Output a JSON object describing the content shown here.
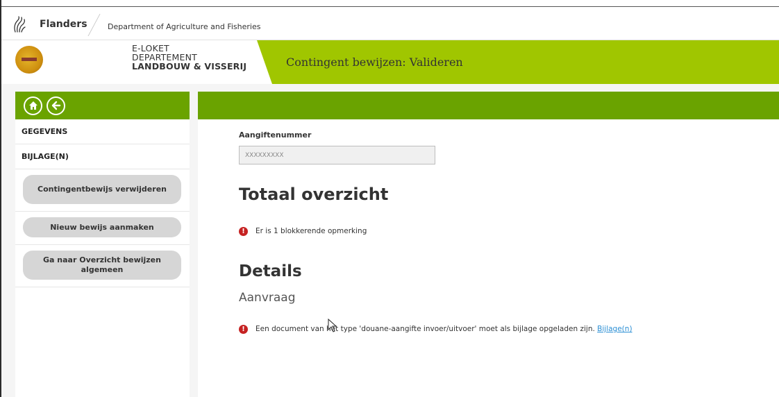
{
  "topbar": {
    "org": "Flanders",
    "department": "Department of Agriculture and Fisheries"
  },
  "header": {
    "eloket_line1": "E-LOKET",
    "eloket_line2": "DEPARTEMENT",
    "eloket_line3": "LANDBOUW & VISSERIJ",
    "page_title": "Contingent bewijzen: Valideren"
  },
  "sidebar": {
    "home_icon": "home-icon",
    "back_icon": "arrow-left-icon",
    "nav": [
      {
        "label": "GEGEVENS"
      },
      {
        "label": "BIJLAGE(N)"
      }
    ],
    "actions": [
      {
        "label": "Contingentbewijs verwijderen"
      },
      {
        "label": "Nieuw bewijs aanmaken"
      },
      {
        "label": "Ga naar Overzicht bewijzen algemeen"
      }
    ]
  },
  "main": {
    "field_label": "Aangiftenummer",
    "field_value": "XXXXXXXXX",
    "total_heading": "Totaal overzicht",
    "total_message": "Er is 1 blokkerende opmerking",
    "details_heading": "Details",
    "section_heading": "Aanvraag",
    "detail_message": "Een document van het type 'douane-aangifte invoer/uitvoer' moet als bijlage opgeladen zijn.",
    "detail_link": "Bijlage(n)"
  },
  "colors": {
    "green_dark": "#6aa300",
    "green_light": "#a0c600",
    "error": "#c62222",
    "link": "#2a8ed4"
  }
}
